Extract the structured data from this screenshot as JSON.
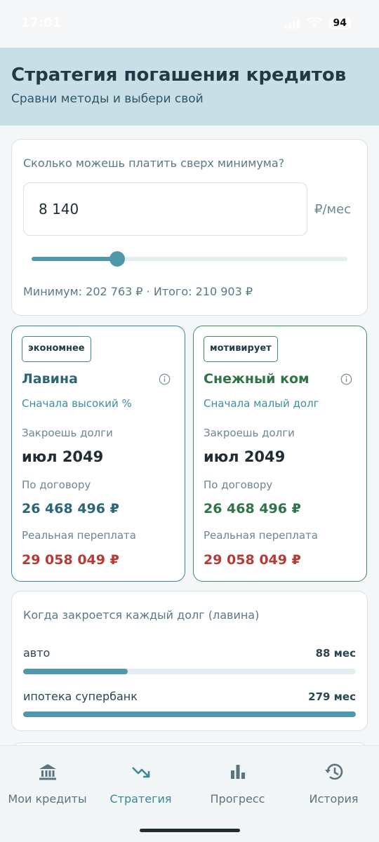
{
  "status_bar": {
    "time": "17:01",
    "battery": "94"
  },
  "header": {
    "title": "Стратегия погашения кредитов",
    "subtitle": "Сравни методы и выбери свой"
  },
  "extra_payment": {
    "label": "Сколько можешь платить сверх минимума?",
    "value": "8 140",
    "unit": "₽/мес",
    "slider_fraction": 0.27,
    "summary": "Минимум: 202 763 ₽ · Итого: 210 903 ₽"
  },
  "strategies": [
    {
      "badge": "экономнее",
      "name": "Лавина",
      "description": "Сначала высокий %",
      "close_label": "Закроешь долги",
      "close_date": "июл 2049",
      "contract_label": "По договору",
      "contract_value": "26 468 496 ₽",
      "overpay_label": "Реальная переплата",
      "overpay_value": "29 058 049 ₽"
    },
    {
      "badge": "мотивирует",
      "name": "Снежный ком",
      "description": "Сначала малый долг",
      "close_label": "Закроешь долги",
      "close_date": "июл 2049",
      "contract_label": "По договору",
      "contract_value": "26 468 496 ₽",
      "overpay_label": "Реальная переплата",
      "overpay_value": "29 058 049 ₽"
    }
  ],
  "closing": {
    "title": "Когда закроется каждый долг (лавина)",
    "debts": [
      {
        "name": "авто",
        "months": "88 мес",
        "fraction": 0.315
      },
      {
        "name": "ипотека супербанк",
        "months": "279 мес",
        "fraction": 1.0
      }
    ]
  },
  "nav": {
    "items": [
      {
        "label": "Мои кредиты",
        "icon": "bank-icon",
        "active": false
      },
      {
        "label": "Стратегия",
        "icon": "trending-down-icon",
        "active": true
      },
      {
        "label": "Прогресс",
        "icon": "bar-chart-icon",
        "active": false
      },
      {
        "label": "История",
        "icon": "history-icon",
        "active": false
      }
    ]
  },
  "colors": {
    "accent": "#3a8899",
    "avalanche": "#3a8899",
    "snowball": "#3f8f5b",
    "overpay": "#b83a35",
    "header_bg": "#c9dfe8"
  }
}
